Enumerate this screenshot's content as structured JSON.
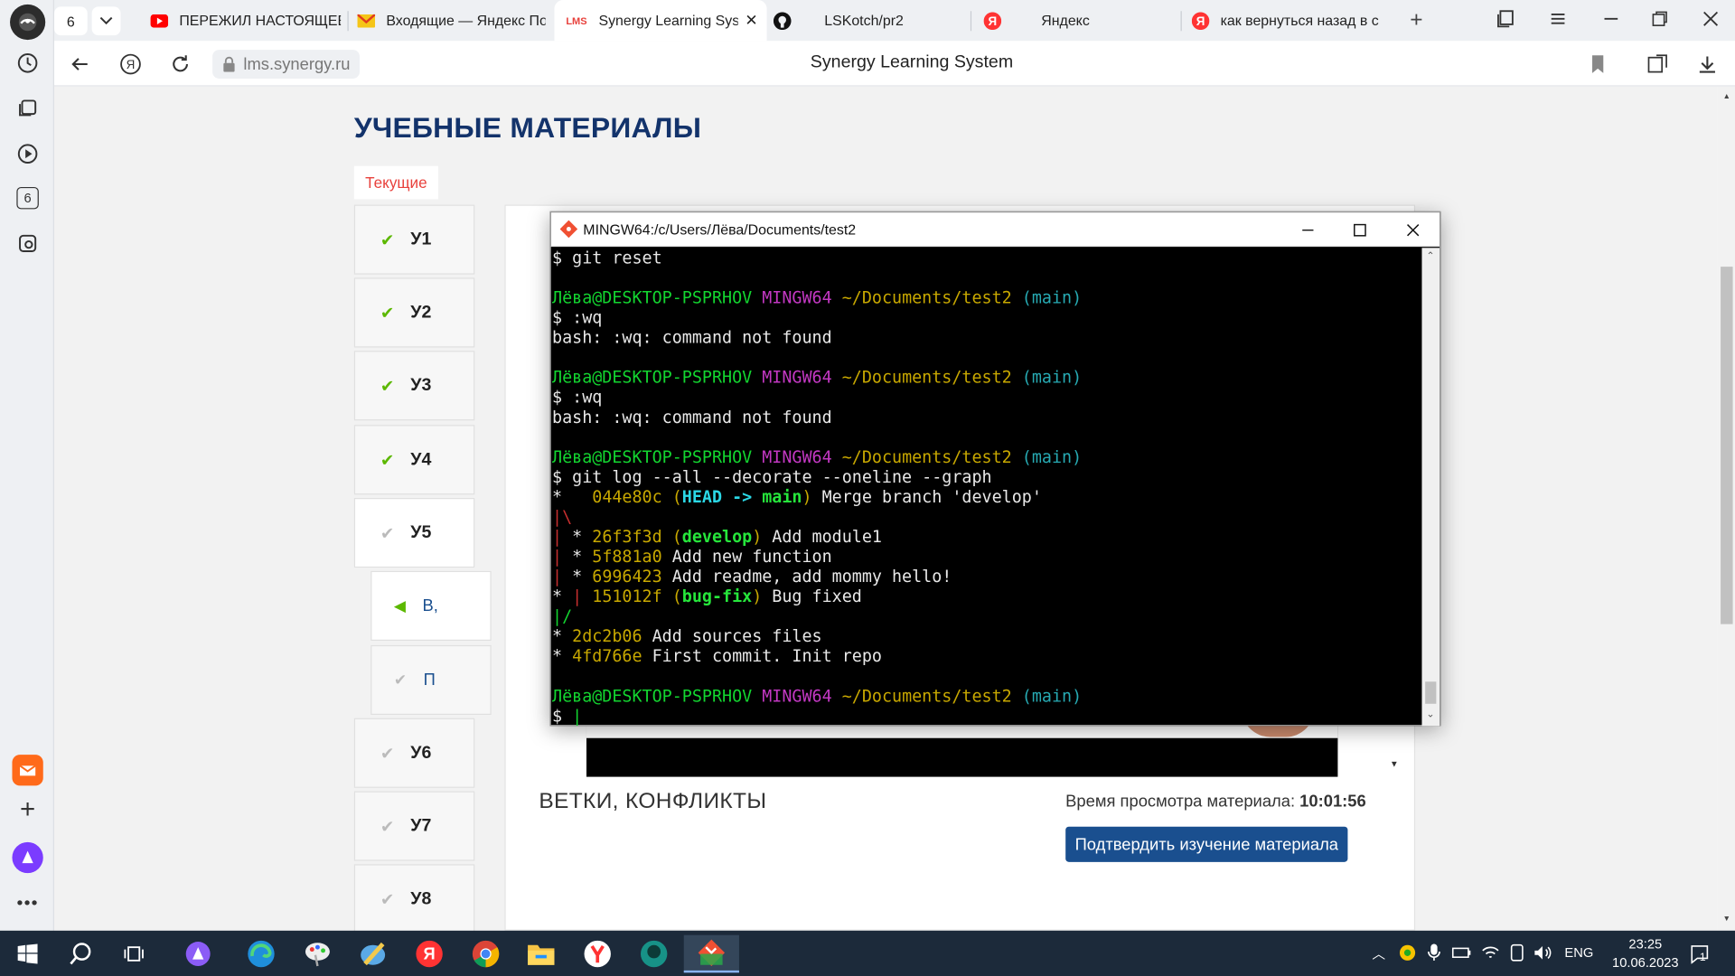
{
  "browser": {
    "tab_counter": "6",
    "tabs": [
      {
        "label": "ПЕРЕЖИЛ НАСТОЯЩЕЕ",
        "icon": "youtube-icon"
      },
      {
        "label": "Входящие — Яндекс По",
        "icon": "mail-icon"
      },
      {
        "label": "Synergy Learning Sys",
        "icon": "lms-icon"
      },
      {
        "label": "LSKotch/pr2",
        "icon": "github-icon"
      },
      {
        "label": "Яндекс",
        "icon": "yandex-icon"
      },
      {
        "label": "как вернуться назад в с",
        "icon": "yandex-icon"
      }
    ],
    "url": "lms.synergy.ru",
    "page_title": "Synergy Learning System",
    "side_panel_badge": "6"
  },
  "page": {
    "heading": "УЧЕБНЫЕ МАТЕРИАЛЫ",
    "tab_current": "Текущие",
    "lessons_top": [
      {
        "label": "У1",
        "status": "done"
      },
      {
        "label": "У2",
        "status": "done"
      },
      {
        "label": "У3",
        "status": "done"
      },
      {
        "label": "У4",
        "status": "done"
      },
      {
        "label": "У5",
        "status": "open"
      }
    ],
    "sublessons": [
      {
        "label": "В,",
        "status": "current"
      },
      {
        "label": "П",
        "status": "pending"
      }
    ],
    "lessons_bottom": [
      {
        "label": "У6",
        "status": "pending"
      },
      {
        "label": "У7",
        "status": "pending"
      },
      {
        "label": "У8",
        "status": "pending"
      }
    ],
    "content_title": "ВЕТКИ, КОНФЛИКТЫ",
    "view_time_label": "Время просмотра материала:",
    "view_time_value": "10:01:56",
    "confirm_button": "Подтвердить изучение материала",
    "colors": {
      "heading": "#13336b",
      "accent_red": "#e8413c",
      "button": "#1a4f8f",
      "check_green": "#5cb800"
    }
  },
  "terminal": {
    "title": "MINGW64:/c/Users/Лёва/Documents/test2",
    "prompt_user": "Лёва@DESKTOP-PSPRHOV",
    "prompt_sys": "MINGW64",
    "prompt_path": "~/Documents/test2",
    "prompt_branch": "(main)",
    "lines": [
      [
        {
          "t": "$ git reset"
        }
      ],
      [
        {
          "t": ""
        }
      ],
      [
        {
          "t": "Лёва@DESKTOP-PSPRHOV",
          "c": "c-g"
        },
        {
          "t": " "
        },
        {
          "t": "MINGW64",
          "c": "c-m"
        },
        {
          "t": " "
        },
        {
          "t": "~/Documents/test2",
          "c": "c-y"
        },
        {
          "t": " "
        },
        {
          "t": "(main)",
          "c": "c-c"
        }
      ],
      [
        {
          "t": "$ :wq"
        }
      ],
      [
        {
          "t": "bash: :wq: command not found"
        }
      ],
      [
        {
          "t": ""
        }
      ],
      [
        {
          "t": "Лёва@DESKTOP-PSPRHOV",
          "c": "c-g"
        },
        {
          "t": " "
        },
        {
          "t": "MINGW64",
          "c": "c-m"
        },
        {
          "t": " "
        },
        {
          "t": "~/Documents/test2",
          "c": "c-y"
        },
        {
          "t": " "
        },
        {
          "t": "(main)",
          "c": "c-c"
        }
      ],
      [
        {
          "t": "$ :wq"
        }
      ],
      [
        {
          "t": "bash: :wq: command not found"
        }
      ],
      [
        {
          "t": ""
        }
      ],
      [
        {
          "t": "Лёва@DESKTOP-PSPRHOV",
          "c": "c-g"
        },
        {
          "t": " "
        },
        {
          "t": "MINGW64",
          "c": "c-m"
        },
        {
          "t": " "
        },
        {
          "t": "~/Documents/test2",
          "c": "c-y"
        },
        {
          "t": " "
        },
        {
          "t": "(main)",
          "c": "c-c"
        }
      ],
      [
        {
          "t": "$ git log --all --decorate --oneline --graph"
        }
      ],
      [
        {
          "t": "*   "
        },
        {
          "t": "044e80c",
          "c": "c-y"
        },
        {
          "t": " "
        },
        {
          "t": "(",
          "c": "c-y"
        },
        {
          "t": "HEAD -> ",
          "c": "c-bc"
        },
        {
          "t": "main",
          "c": "c-bg"
        },
        {
          "t": ")",
          "c": "c-y"
        },
        {
          "t": " Merge branch 'develop'"
        }
      ],
      [
        {
          "t": "|\\",
          "c": "c-r"
        }
      ],
      [
        {
          "t": "|",
          "c": "c-r"
        },
        {
          "t": " * "
        },
        {
          "t": "26f3f3d",
          "c": "c-y"
        },
        {
          "t": " "
        },
        {
          "t": "(",
          "c": "c-y"
        },
        {
          "t": "develop",
          "c": "c-bg"
        },
        {
          "t": ")",
          "c": "c-y"
        },
        {
          "t": " Add module1"
        }
      ],
      [
        {
          "t": "|",
          "c": "c-r"
        },
        {
          "t": " * "
        },
        {
          "t": "5f881a0",
          "c": "c-y"
        },
        {
          "t": " Add new function"
        }
      ],
      [
        {
          "t": "|",
          "c": "c-r"
        },
        {
          "t": " * "
        },
        {
          "t": "6996423",
          "c": "c-y"
        },
        {
          "t": " Add readme, add mommy hello!"
        }
      ],
      [
        {
          "t": "* "
        },
        {
          "t": "|",
          "c": "c-r"
        },
        {
          "t": " "
        },
        {
          "t": "151012f",
          "c": "c-y"
        },
        {
          "t": " "
        },
        {
          "t": "(",
          "c": "c-y"
        },
        {
          "t": "bug-fix",
          "c": "c-bg"
        },
        {
          "t": ")",
          "c": "c-y"
        },
        {
          "t": " Bug fixed"
        }
      ],
      [
        {
          "t": "|/",
          "c": "c-g"
        }
      ],
      [
        {
          "t": "* "
        },
        {
          "t": "2dc2b06",
          "c": "c-y"
        },
        {
          "t": " Add sources files"
        }
      ],
      [
        {
          "t": "* "
        },
        {
          "t": "4fd766e",
          "c": "c-y"
        },
        {
          "t": " First commit. Init repo"
        }
      ],
      [
        {
          "t": ""
        }
      ],
      [
        {
          "t": "Лёва@DESKTOP-PSPRHOV",
          "c": "c-g"
        },
        {
          "t": " "
        },
        {
          "t": "MINGW64",
          "c": "c-m"
        },
        {
          "t": " "
        },
        {
          "t": "~/Documents/test2",
          "c": "c-y"
        },
        {
          "t": " "
        },
        {
          "t": "(main)",
          "c": "c-c"
        }
      ],
      [
        {
          "t": "$ "
        },
        {
          "t": "|",
          "c": "c-g"
        }
      ]
    ]
  },
  "taskbar": {
    "apps": [
      "windows-start-icon",
      "search-icon",
      "task-view-icon",
      "alisa-icon",
      "edge-icon",
      "paint-icon",
      "drawing-icon",
      "yandex-browser-icon",
      "chrome-icon",
      "file-explorer-icon",
      "yandex-app-icon",
      "gitkraken-icon",
      "git-bash-icon"
    ],
    "lang": "ENG",
    "time": "23:25",
    "date": "10.06.2023",
    "notifications": "1"
  }
}
